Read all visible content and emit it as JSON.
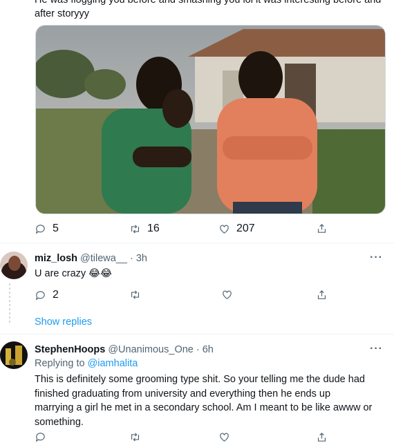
{
  "tweet_top": {
    "text_line1": "He was flogging you before and smashing you lol it was interesting before and",
    "text_line2": "after storyyy",
    "replies": "5",
    "retweets": "16",
    "likes": "207"
  },
  "reply1": {
    "name": "miz_losh",
    "handle": "@tilewa__",
    "time": "· 3h",
    "text": "U are crazy 😂😂",
    "replies": "2",
    "more": "···",
    "show_replies": "Show replies"
  },
  "reply2": {
    "name": "StephenHoops",
    "handle": "@Unanimous_One",
    "time": "· 6h",
    "replying_prefix": "Replying to",
    "replying_to": "@iamhalita",
    "more": "···",
    "text_lines": [
      "This is definitely some grooming type shit. So your telling me the dude had",
      "finished graduating from university and everything then he ends up",
      "marrying a girl he met in a secondary school. Am I meant to be like awww or",
      "something."
    ]
  },
  "colors": {
    "accent": "#1d9bf0",
    "muted": "#536471"
  }
}
